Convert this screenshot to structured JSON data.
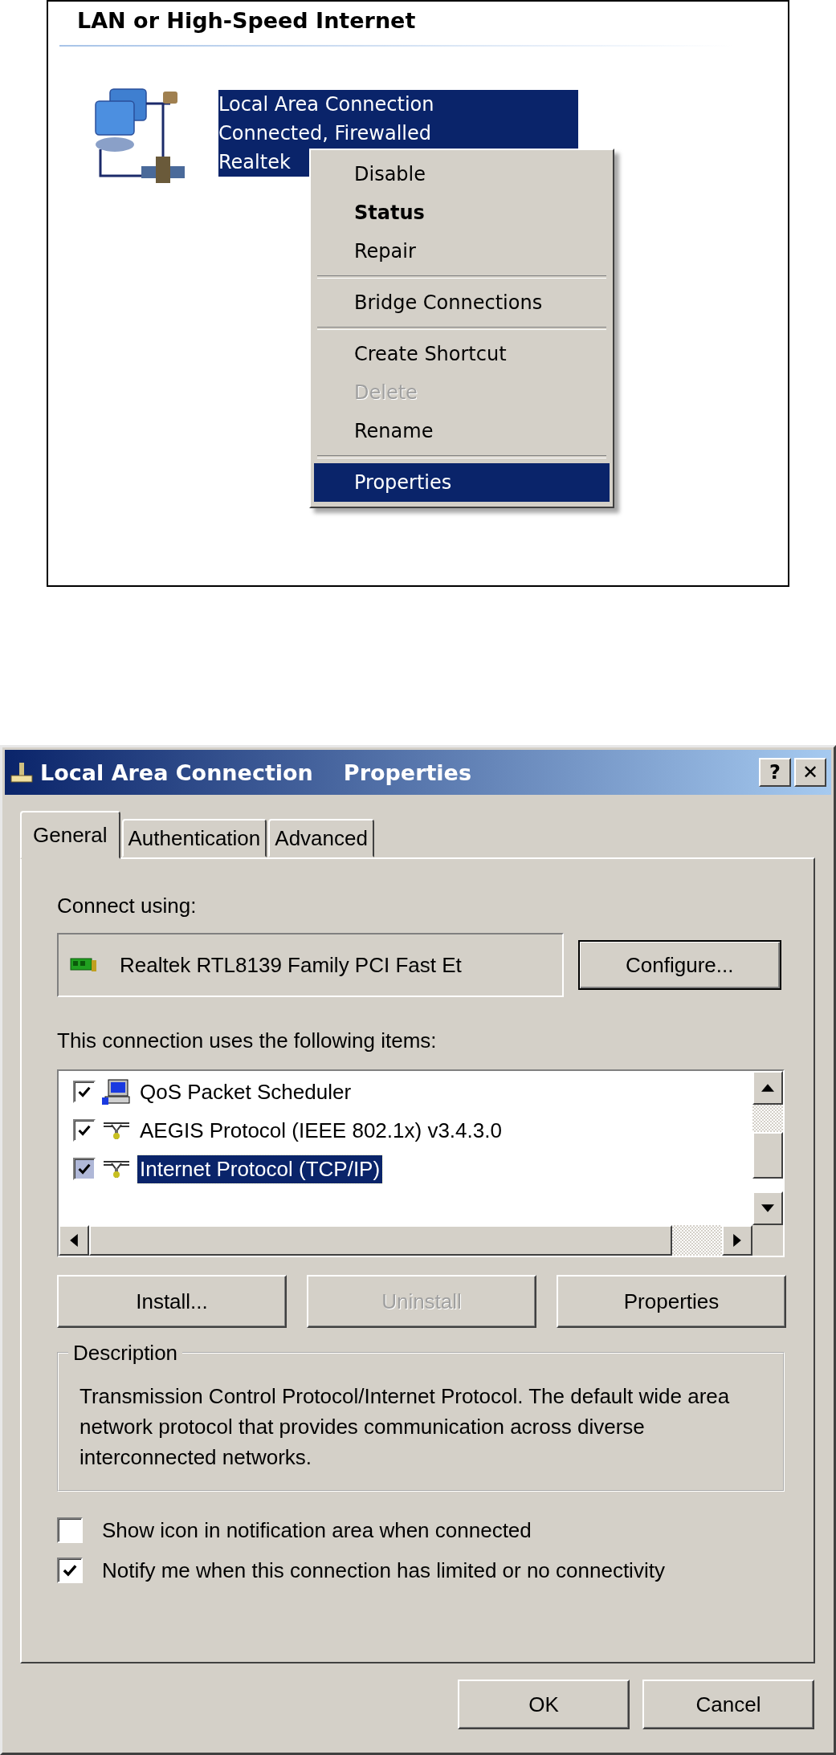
{
  "connections_panel": {
    "heading": "LAN or High-Speed Internet",
    "connection": {
      "selected": true,
      "lines": [
        "Local Area Connection",
        "Connected, Firewalled",
        "Realtek"
      ]
    }
  },
  "context_menu": {
    "items": [
      {
        "kind": "item",
        "label": "Disable",
        "default": false,
        "disabled": false,
        "selected": false
      },
      {
        "kind": "item",
        "label": "Status",
        "default": true,
        "disabled": false,
        "selected": false
      },
      {
        "kind": "item",
        "label": "Repair",
        "default": false,
        "disabled": false,
        "selected": false
      },
      {
        "kind": "separator"
      },
      {
        "kind": "item",
        "label": "Bridge Connections",
        "default": false,
        "disabled": false,
        "selected": false
      },
      {
        "kind": "separator"
      },
      {
        "kind": "item",
        "label": "Create Shortcut",
        "default": false,
        "disabled": false,
        "selected": false
      },
      {
        "kind": "item",
        "label": "Delete",
        "default": false,
        "disabled": true,
        "selected": false
      },
      {
        "kind": "item",
        "label": "Rename",
        "default": false,
        "disabled": false,
        "selected": false
      },
      {
        "kind": "separator"
      },
      {
        "kind": "item",
        "label": "Properties",
        "default": false,
        "disabled": false,
        "selected": true
      }
    ]
  },
  "dialog": {
    "title": "Local Area Connection",
    "title_suffix": "Properties",
    "help_button": "?",
    "close_button": "✕",
    "tabs": [
      {
        "label": "General",
        "selected": true
      },
      {
        "label": "Authentication",
        "selected": false
      },
      {
        "label": "Advanced",
        "selected": false
      }
    ],
    "connect_using": {
      "label": "Connect using:",
      "adapter": "Realtek RTL8139 Family PCI Fast Et",
      "button": "Configure..."
    },
    "items_label": "This connection uses the following items:",
    "items": [
      {
        "kind": "service",
        "label": "QoS Packet Scheduler",
        "checked": true,
        "selected": false
      },
      {
        "kind": "protocol",
        "label": "AEGIS Protocol (IEEE 802.1x) v3.4.3.0",
        "checked": true,
        "selected": false
      },
      {
        "kind": "protocol",
        "label": "Internet Protocol (TCP/IP)",
        "checked": true,
        "selected": true
      }
    ],
    "item_buttons": [
      {
        "label": "Install...",
        "disabled": false
      },
      {
        "label": "Uninstall",
        "disabled": true
      },
      {
        "label": "Properties",
        "disabled": false
      }
    ],
    "description": {
      "legend": "Description",
      "text": "Transmission Control Protocol/Internet Protocol. The default wide area network protocol that provides communication across diverse interconnected networks."
    },
    "options": [
      {
        "label": "Show icon in notification area when connected",
        "checked": false
      },
      {
        "label": "Notify me when this connection has limited or no connectivity",
        "checked": true
      }
    ],
    "footer_buttons": [
      {
        "label": "OK"
      },
      {
        "label": "Cancel"
      }
    ]
  }
}
